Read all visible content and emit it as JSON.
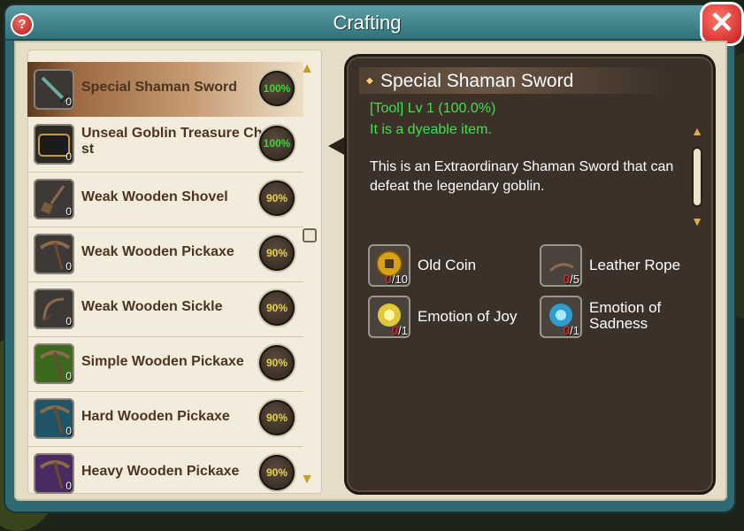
{
  "window": {
    "title": "Crafting",
    "help_symbol": "?",
    "close_symbol": "✕"
  },
  "list": {
    "items": [
      {
        "name": "Special Shaman Sword",
        "count": "0",
        "rate": "100%",
        "selected": true,
        "icon": "shaman-sword-icon"
      },
      {
        "name": "Unseal Goblin Treasure Ch st",
        "count": "0",
        "rate": "100%",
        "selected": false,
        "icon": "treasure-chest-icon"
      },
      {
        "name": "Weak Wooden Shovel",
        "count": "0",
        "rate": "90%",
        "selected": false,
        "icon": "shovel-icon"
      },
      {
        "name": "Weak Wooden Pickaxe",
        "count": "0",
        "rate": "90%",
        "selected": false,
        "icon": "pickaxe-icon"
      },
      {
        "name": "Weak Wooden Sickle",
        "count": "0",
        "rate": "90%",
        "selected": false,
        "icon": "sickle-icon"
      },
      {
        "name": "Simple Wooden Pickaxe",
        "count": "0",
        "rate": "90%",
        "selected": false,
        "icon": "pickaxe-icon"
      },
      {
        "name": "Hard Wooden Pickaxe",
        "count": "0",
        "rate": "90%",
        "selected": false,
        "icon": "pickaxe-icon"
      },
      {
        "name": "Heavy Wooden Pickaxe",
        "count": "0",
        "rate": "90%",
        "selected": false,
        "icon": "pickaxe-icon"
      }
    ]
  },
  "detail": {
    "title": "Special Shaman Sword",
    "type_line": "[Tool] Lv 1 (100.0%)",
    "dye_line": "It is a dyeable item.",
    "description": "This is an Extraordinary Shaman Sword that can defeat the legendary goblin.",
    "materials": [
      {
        "name": "Old Coin",
        "have": "0",
        "need": "/10",
        "icon": "old-coin-icon"
      },
      {
        "name": "Leather Rope",
        "have": "0",
        "need": "/5",
        "icon": "leather-rope-icon"
      },
      {
        "name": "Emotion of Joy",
        "have": "0",
        "need": "/1",
        "icon": "emotion-joy-icon"
      },
      {
        "name": "Emotion of Sadness",
        "have": "0",
        "need": "/1",
        "icon": "emotion-sadness-icon"
      }
    ]
  },
  "colors": {
    "success_full": "#39d63a",
    "success_partial": "#e8d14c",
    "info_green": "#3fe04a",
    "missing_red": "#ff2b2b",
    "frame_teal": "#2f6a72",
    "detail_bg": "#3b3128"
  }
}
